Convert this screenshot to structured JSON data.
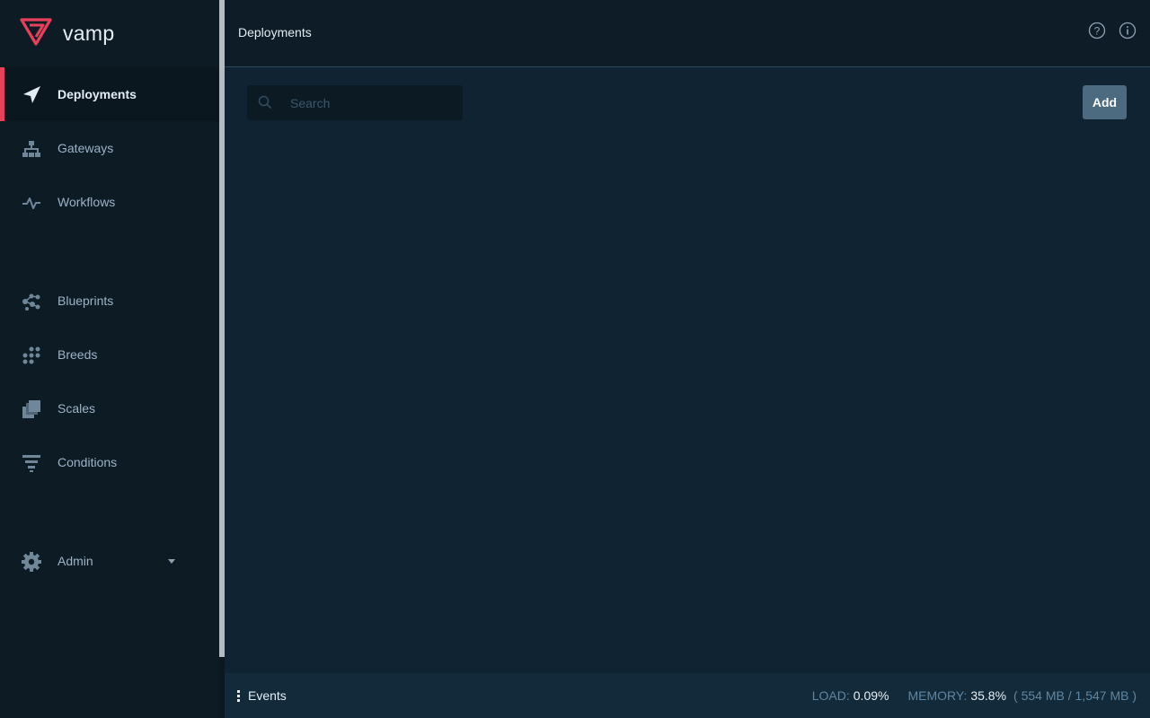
{
  "brand": {
    "name": "vamp"
  },
  "sidebar": {
    "items": [
      {
        "label": "Deployments",
        "icon": "paper-plane-icon"
      },
      {
        "label": "Gateways",
        "icon": "sitemap-icon"
      },
      {
        "label": "Workflows",
        "icon": "pulse-icon"
      },
      {
        "label": "Blueprints",
        "icon": "blueprint-icon"
      },
      {
        "label": "Breeds",
        "icon": "grid-dots-icon"
      },
      {
        "label": "Scales",
        "icon": "layers-icon"
      },
      {
        "label": "Conditions",
        "icon": "filter-icon"
      },
      {
        "label": "Admin",
        "icon": "gear-icon"
      }
    ]
  },
  "header": {
    "title": "Deployments"
  },
  "main": {
    "search_placeholder": "Search",
    "add_label": "Add"
  },
  "footer": {
    "events_label": "Events",
    "load_label": "LOAD:",
    "load_value": "0.09%",
    "memory_label": "MEMORY:",
    "memory_value": "35.8%",
    "memory_detail": "( 554 MB / 1,547 MB )"
  },
  "colors": {
    "accent": "#e8405a",
    "sidebar_bg": "#0d1b25",
    "main_bg": "#0f2332",
    "button_bg": "#4c6b80"
  }
}
